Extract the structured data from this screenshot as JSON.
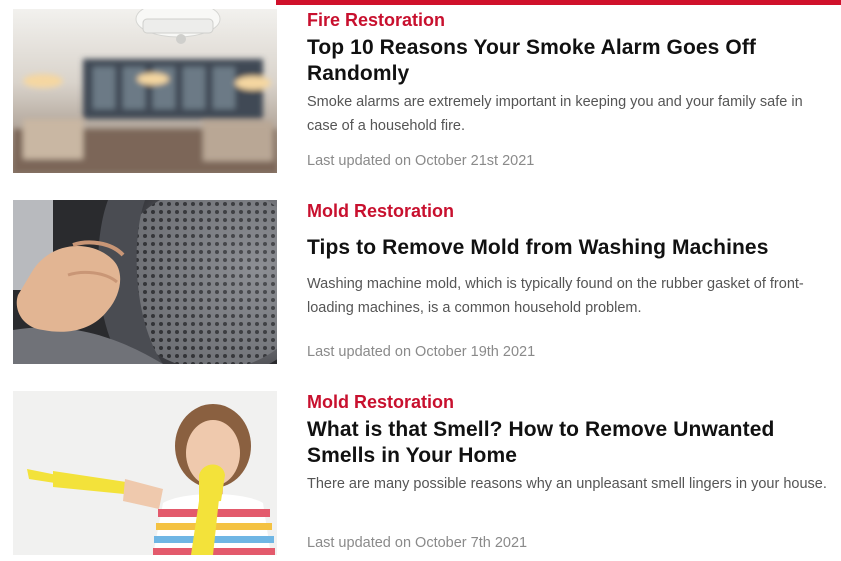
{
  "accent_color": "#d0112b",
  "articles": [
    {
      "category": "Fire Restoration",
      "title": "Top 10 Reasons Your Smoke Alarm Goes Off Randomly",
      "excerpt": "Smoke alarms are extremely important in keeping you and your family safe in case of a household fire.",
      "updated": "Last updated on October 21st 2021",
      "image": "smoke-alarm-kitchen-photo"
    },
    {
      "category": "Mold Restoration",
      "title": "Tips to Remove Mold from Washing Machines",
      "excerpt": "Washing machine mold, which is typically found on the rubber gasket of front-loading machines, is a common household problem.",
      "updated": "Last updated on October 19th 2021",
      "image": "washing-machine-gasket-photo"
    },
    {
      "category": "Mold Restoration",
      "title": "What is that Smell? How to Remove Unwanted Smells in Your Home",
      "excerpt": "There are many possible reasons why an unpleasant smell lingers in your house.",
      "updated": "Last updated on October 7th 2021",
      "image": "woman-holding-nose-photo"
    }
  ]
}
